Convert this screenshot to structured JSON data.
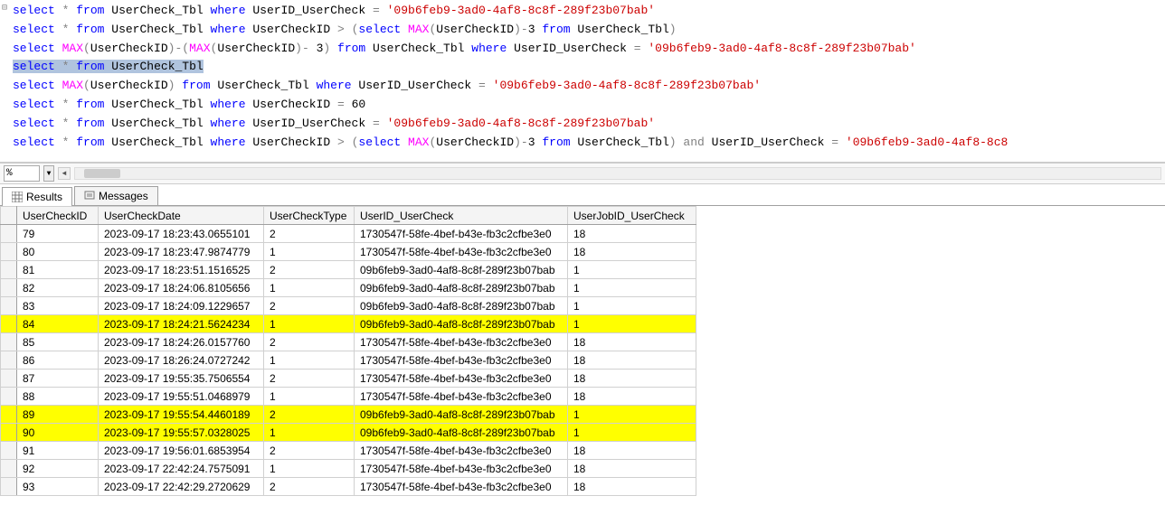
{
  "zoom": "%",
  "tabs": {
    "results": "Results",
    "messages": "Messages"
  },
  "columns": [
    "UserCheckID",
    "UserCheckDate",
    "UserCheckType",
    "UserID_UserCheck",
    "UserJobID_UserCheck"
  ],
  "rows": [
    {
      "c0": "79",
      "c1": "2023-09-17 18:23:43.0655101",
      "c2": "2",
      "c3": "1730547f-58fe-4bef-b43e-fb3c2cfbe3e0",
      "c4": "18",
      "hl": false
    },
    {
      "c0": "80",
      "c1": "2023-09-17 18:23:47.9874779",
      "c2": "1",
      "c3": "1730547f-58fe-4bef-b43e-fb3c2cfbe3e0",
      "c4": "18",
      "hl": false
    },
    {
      "c0": "81",
      "c1": "2023-09-17 18:23:51.1516525",
      "c2": "2",
      "c3": "09b6feb9-3ad0-4af8-8c8f-289f23b07bab",
      "c4": "1",
      "hl": false
    },
    {
      "c0": "82",
      "c1": "2023-09-17 18:24:06.8105656",
      "c2": "1",
      "c3": "09b6feb9-3ad0-4af8-8c8f-289f23b07bab",
      "c4": "1",
      "hl": false
    },
    {
      "c0": "83",
      "c1": "2023-09-17 18:24:09.1229657",
      "c2": "2",
      "c3": "09b6feb9-3ad0-4af8-8c8f-289f23b07bab",
      "c4": "1",
      "hl": false
    },
    {
      "c0": "84",
      "c1": "2023-09-17 18:24:21.5624234",
      "c2": "1",
      "c3": "09b6feb9-3ad0-4af8-8c8f-289f23b07bab",
      "c4": "1",
      "hl": true
    },
    {
      "c0": "85",
      "c1": "2023-09-17 18:24:26.0157760",
      "c2": "2",
      "c3": "1730547f-58fe-4bef-b43e-fb3c2cfbe3e0",
      "c4": "18",
      "hl": false
    },
    {
      "c0": "86",
      "c1": "2023-09-17 18:26:24.0727242",
      "c2": "1",
      "c3": "1730547f-58fe-4bef-b43e-fb3c2cfbe3e0",
      "c4": "18",
      "hl": false
    },
    {
      "c0": "87",
      "c1": "2023-09-17 19:55:35.7506554",
      "c2": "2",
      "c3": "1730547f-58fe-4bef-b43e-fb3c2cfbe3e0",
      "c4": "18",
      "hl": false
    },
    {
      "c0": "88",
      "c1": "2023-09-17 19:55:51.0468979",
      "c2": "1",
      "c3": "1730547f-58fe-4bef-b43e-fb3c2cfbe3e0",
      "c4": "18",
      "hl": false
    },
    {
      "c0": "89",
      "c1": "2023-09-17 19:55:54.4460189",
      "c2": "2",
      "c3": "09b6feb9-3ad0-4af8-8c8f-289f23b07bab",
      "c4": "1",
      "hl": true
    },
    {
      "c0": "90",
      "c1": "2023-09-17 19:55:57.0328025",
      "c2": "1",
      "c3": "09b6feb9-3ad0-4af8-8c8f-289f23b07bab",
      "c4": "1",
      "hl": true
    },
    {
      "c0": "91",
      "c1": "2023-09-17 19:56:01.6853954",
      "c2": "2",
      "c3": "1730547f-58fe-4bef-b43e-fb3c2cfbe3e0",
      "c4": "18",
      "hl": false
    },
    {
      "c0": "92",
      "c1": "2023-09-17 22:42:24.7575091",
      "c2": "1",
      "c3": "1730547f-58fe-4bef-b43e-fb3c2cfbe3e0",
      "c4": "18",
      "hl": false
    },
    {
      "c0": "93",
      "c1": "2023-09-17 22:42:29.2720629",
      "c2": "2",
      "c3": "1730547f-58fe-4bef-b43e-fb3c2cfbe3e0",
      "c4": "18",
      "hl": false
    }
  ],
  "sql": {
    "tokens": [
      [
        {
          "t": "select",
          "c": "kw-blue"
        },
        {
          "t": " "
        },
        {
          "t": "*",
          "c": "kw-grey"
        },
        {
          "t": " "
        },
        {
          "t": "from",
          "c": "kw-blue"
        },
        {
          "t": " "
        },
        {
          "t": "UserCheck_Tbl",
          "c": "ident"
        },
        {
          "t": " "
        },
        {
          "t": "where",
          "c": "kw-blue"
        },
        {
          "t": " "
        },
        {
          "t": "UserID_UserCheck",
          "c": "ident"
        },
        {
          "t": " "
        },
        {
          "t": "=",
          "c": "kw-grey"
        },
        {
          "t": " "
        },
        {
          "t": "'09b6feb9-3ad0-4af8-8c8f-289f23b07bab'",
          "c": "str-red"
        }
      ],
      [
        {
          "t": "select",
          "c": "kw-blue"
        },
        {
          "t": " "
        },
        {
          "t": "*",
          "c": "kw-grey"
        },
        {
          "t": " "
        },
        {
          "t": "from",
          "c": "kw-blue"
        },
        {
          "t": " "
        },
        {
          "t": "UserCheck_Tbl",
          "c": "ident"
        },
        {
          "t": " "
        },
        {
          "t": "where",
          "c": "kw-blue"
        },
        {
          "t": " "
        },
        {
          "t": "UserCheckID",
          "c": "ident"
        },
        {
          "t": " "
        },
        {
          "t": ">",
          "c": "kw-grey"
        },
        {
          "t": " "
        },
        {
          "t": "(",
          "c": "kw-grey"
        },
        {
          "t": "select",
          "c": "kw-blue"
        },
        {
          "t": " "
        },
        {
          "t": "MAX",
          "c": "kw-mag"
        },
        {
          "t": "(",
          "c": "kw-grey"
        },
        {
          "t": "UserCheckID",
          "c": "ident"
        },
        {
          "t": ")",
          "c": "kw-grey"
        },
        {
          "t": "-",
          "c": "kw-grey"
        },
        {
          "t": "3",
          "c": "num"
        },
        {
          "t": " "
        },
        {
          "t": "from",
          "c": "kw-blue"
        },
        {
          "t": " "
        },
        {
          "t": "UserCheck_Tbl",
          "c": "ident"
        },
        {
          "t": ")",
          "c": "kw-grey"
        }
      ],
      [
        {
          "t": "select",
          "c": "kw-blue"
        },
        {
          "t": " "
        },
        {
          "t": "MAX",
          "c": "kw-mag"
        },
        {
          "t": "(",
          "c": "kw-grey"
        },
        {
          "t": "UserCheckID",
          "c": "ident"
        },
        {
          "t": ")",
          "c": "kw-grey"
        },
        {
          "t": "-",
          "c": "kw-grey"
        },
        {
          "t": "(",
          "c": "kw-grey"
        },
        {
          "t": "MAX",
          "c": "kw-mag"
        },
        {
          "t": "(",
          "c": "kw-grey"
        },
        {
          "t": "UserCheckID",
          "c": "ident"
        },
        {
          "t": ")",
          "c": "kw-grey"
        },
        {
          "t": "-",
          "c": "kw-grey"
        },
        {
          "t": " 3",
          "c": "num"
        },
        {
          "t": ")",
          "c": "kw-grey"
        },
        {
          "t": " "
        },
        {
          "t": "from",
          "c": "kw-blue"
        },
        {
          "t": " "
        },
        {
          "t": "UserCheck_Tbl",
          "c": "ident"
        },
        {
          "t": " "
        },
        {
          "t": "where",
          "c": "kw-blue"
        },
        {
          "t": " "
        },
        {
          "t": "UserID_UserCheck",
          "c": "ident"
        },
        {
          "t": " "
        },
        {
          "t": "=",
          "c": "kw-grey"
        },
        {
          "t": " "
        },
        {
          "t": "'09b6feb9-3ad0-4af8-8c8f-289f23b07bab'",
          "c": "str-red"
        }
      ],
      [
        {
          "t": "select",
          "c": "kw-blue",
          "sel": true
        },
        {
          "t": " ",
          "sel": true
        },
        {
          "t": "*",
          "c": "kw-grey",
          "sel": true
        },
        {
          "t": " ",
          "sel": true
        },
        {
          "t": "from",
          "c": "kw-blue",
          "sel": true
        },
        {
          "t": " ",
          "sel": true
        },
        {
          "t": "UserCheck_Tbl",
          "c": "ident",
          "sel": true
        }
      ],
      [
        {
          "t": "select",
          "c": "kw-blue"
        },
        {
          "t": " "
        },
        {
          "t": "MAX",
          "c": "kw-mag"
        },
        {
          "t": "(",
          "c": "kw-grey"
        },
        {
          "t": "UserCheckID",
          "c": "ident"
        },
        {
          "t": ")",
          "c": "kw-grey"
        },
        {
          "t": " "
        },
        {
          "t": "from",
          "c": "kw-blue"
        },
        {
          "t": " "
        },
        {
          "t": "UserCheck_Tbl",
          "c": "ident"
        },
        {
          "t": " "
        },
        {
          "t": "where",
          "c": "kw-blue"
        },
        {
          "t": " "
        },
        {
          "t": "UserID_UserCheck",
          "c": "ident"
        },
        {
          "t": " "
        },
        {
          "t": "=",
          "c": "kw-grey"
        },
        {
          "t": " "
        },
        {
          "t": "'09b6feb9-3ad0-4af8-8c8f-289f23b07bab'",
          "c": "str-red"
        }
      ],
      [
        {
          "t": "select",
          "c": "kw-blue"
        },
        {
          "t": " "
        },
        {
          "t": "*",
          "c": "kw-grey"
        },
        {
          "t": " "
        },
        {
          "t": "from",
          "c": "kw-blue"
        },
        {
          "t": " "
        },
        {
          "t": "UserCheck_Tbl",
          "c": "ident"
        },
        {
          "t": " "
        },
        {
          "t": "where",
          "c": "kw-blue"
        },
        {
          "t": " "
        },
        {
          "t": "UserCheckID",
          "c": "ident"
        },
        {
          "t": " "
        },
        {
          "t": "=",
          "c": "kw-grey"
        },
        {
          "t": " 60",
          "c": "num"
        }
      ],
      [
        {
          "t": "select",
          "c": "kw-blue"
        },
        {
          "t": " "
        },
        {
          "t": "*",
          "c": "kw-grey"
        },
        {
          "t": " "
        },
        {
          "t": "from",
          "c": "kw-blue"
        },
        {
          "t": " "
        },
        {
          "t": "UserCheck_Tbl",
          "c": "ident"
        },
        {
          "t": " "
        },
        {
          "t": "where",
          "c": "kw-blue"
        },
        {
          "t": " "
        },
        {
          "t": "UserID_UserCheck",
          "c": "ident"
        },
        {
          "t": " "
        },
        {
          "t": "=",
          "c": "kw-grey"
        },
        {
          "t": " "
        },
        {
          "t": "'09b6feb9-3ad0-4af8-8c8f-289f23b07bab'",
          "c": "str-red"
        }
      ],
      [
        {
          "t": "select",
          "c": "kw-blue"
        },
        {
          "t": " "
        },
        {
          "t": "*",
          "c": "kw-grey"
        },
        {
          "t": " "
        },
        {
          "t": "from",
          "c": "kw-blue"
        },
        {
          "t": " "
        },
        {
          "t": "UserCheck_Tbl",
          "c": "ident"
        },
        {
          "t": " "
        },
        {
          "t": "where",
          "c": "kw-blue"
        },
        {
          "t": " "
        },
        {
          "t": "UserCheckID",
          "c": "ident"
        },
        {
          "t": " "
        },
        {
          "t": ">",
          "c": "kw-grey"
        },
        {
          "t": " "
        },
        {
          "t": "(",
          "c": "kw-grey"
        },
        {
          "t": "select",
          "c": "kw-blue"
        },
        {
          "t": " "
        },
        {
          "t": "MAX",
          "c": "kw-mag"
        },
        {
          "t": "(",
          "c": "kw-grey"
        },
        {
          "t": "UserCheckID",
          "c": "ident"
        },
        {
          "t": ")",
          "c": "kw-grey"
        },
        {
          "t": "-",
          "c": "kw-grey"
        },
        {
          "t": "3",
          "c": "num"
        },
        {
          "t": " "
        },
        {
          "t": "from",
          "c": "kw-blue"
        },
        {
          "t": " "
        },
        {
          "t": "UserCheck_Tbl",
          "c": "ident"
        },
        {
          "t": ")",
          "c": "kw-grey"
        },
        {
          "t": " "
        },
        {
          "t": "and",
          "c": "kw-grey"
        },
        {
          "t": " "
        },
        {
          "t": "UserID_UserCheck",
          "c": "ident"
        },
        {
          "t": " "
        },
        {
          "t": "=",
          "c": "kw-grey"
        },
        {
          "t": " "
        },
        {
          "t": "'09b6feb9-3ad0-4af8-8c8",
          "c": "str-red"
        }
      ]
    ]
  }
}
